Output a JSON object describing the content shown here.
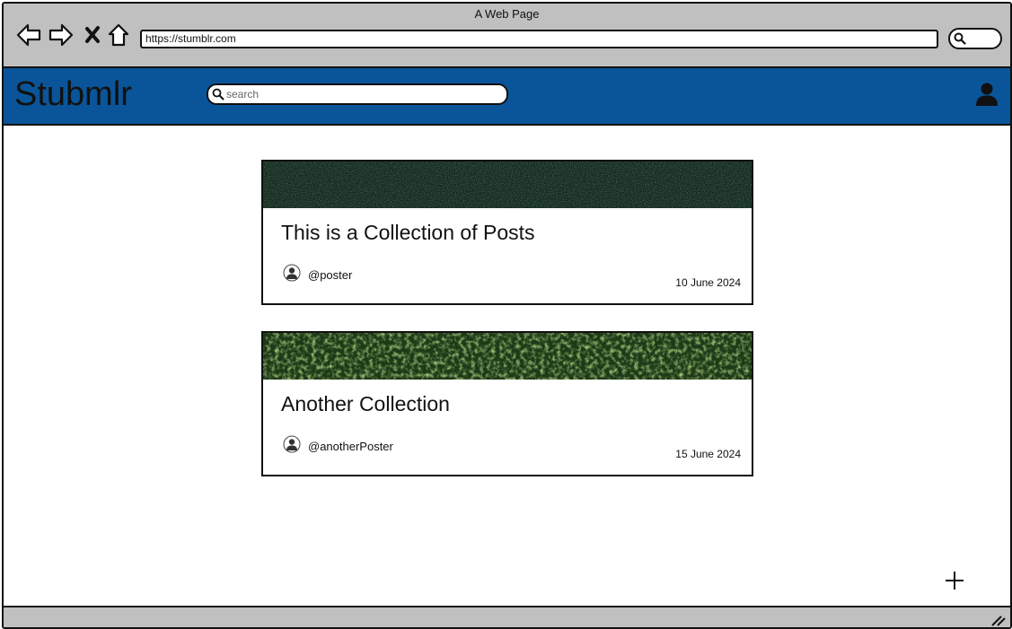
{
  "browser": {
    "window_title": "A Web Page",
    "url": "https://stumblr.com"
  },
  "app": {
    "logo": "Stubmlr",
    "search_placeholder": "search",
    "colors": {
      "header_bg": "#0a5599",
      "chrome_bg": "#c0c0c0"
    }
  },
  "icons": [
    "back-arrow-icon",
    "forward-arrow-icon",
    "close-x-icon",
    "home-icon",
    "search-icon",
    "user-icon",
    "plus-icon",
    "resize-grip-icon"
  ],
  "posts": [
    {
      "title": "This is a Collection of Posts",
      "author": "@poster",
      "date": "10 June 2024",
      "image": "dark-green-texture"
    },
    {
      "title": "Another Collection",
      "author": "@anotherPoster",
      "date": "15 June 2024",
      "image": "forest-canopy"
    }
  ]
}
